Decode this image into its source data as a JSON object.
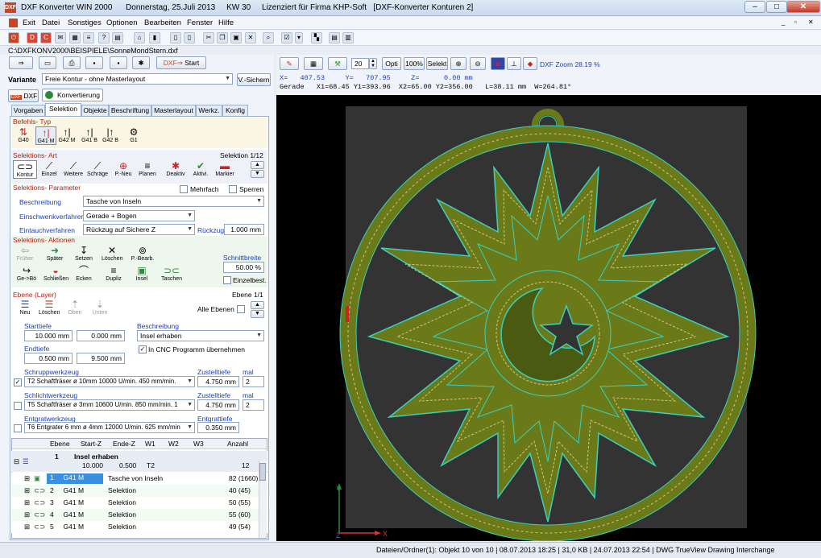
{
  "window": {
    "title": "DXF Konverter WIN 2000      Donnerstag, 25.Juli 2013     KW 30     Lizenziert für Firma KHP-Soft   [DXF-Konverter Konturen 2]",
    "app_icon": "DXF"
  },
  "menu": [
    "Exit",
    "Datei",
    "Sonstiges",
    "Optionen",
    "Bearbeiten",
    "Fenster",
    "Hilfe"
  ],
  "path": "C:\\DXFKONV2000\\BEISPIELE\\SonneMondStern.dxf",
  "start_label": "Start",
  "variante": {
    "label": "Variante",
    "value": "Freie Kontur - ohne Masterlayout",
    "save": "V.-Sichern"
  },
  "doc_tabs": [
    "DXF",
    "Konvertierung"
  ],
  "tabs": [
    "Vorgaben",
    "Selektion",
    "Objekte",
    "Beschriftung",
    "Masterlayout",
    "Werkz.",
    "Konfig"
  ],
  "befehl": {
    "title": "Befehls- Typ",
    "items": [
      "G40",
      "G41 M",
      "G42 M",
      "G41 B",
      "G42 B",
      "G1"
    ]
  },
  "selart": {
    "title": "Selektions- Art",
    "counter": "Selektion 1/12",
    "items": [
      "Kontur",
      "Einzel",
      "Weitere",
      "Schräge",
      "P.-Neu",
      "Planen",
      "Deaktiv",
      "Aktivi.",
      "Markier"
    ]
  },
  "param": {
    "title": "Selektions- Parameter",
    "mehrfach": "Mehrfach",
    "sperren": "Sperren",
    "beschreibung_label": "Beschreibung",
    "beschreibung": "Tasche von Inseln",
    "einschwenk_label": "Einschwenkverfahren",
    "einschwenk": "Gerade + Bogen",
    "eintauch_label": "Eintauchverfahren",
    "eintauch": "Rückzug auf Sichere Z",
    "rueckzug_label": "Rückzug",
    "rueckzug": "1.000 mm"
  },
  "aktionen": {
    "title": "Selektions- Aktionen",
    "row1": [
      "Früher",
      "Später",
      "Setzen",
      "Löschen",
      "P.-Bearb."
    ],
    "row2": [
      "Ge->Bö",
      "Schließen",
      "Ecken",
      "Dupliz",
      "Insel",
      "Taschen"
    ],
    "schnitt_label": "Schnittbreite",
    "schnitt": "50.00 %",
    "einzel": "Einzelbest."
  },
  "ebene": {
    "title": "Ebene (Layer)",
    "counter": "Ebene 1/1",
    "buttons": [
      "Neu",
      "Löschen",
      "Oben",
      "Unten"
    ],
    "alle": "Alle Ebenen",
    "starttiefe_label": "Starttiefe",
    "st1": "10.000 mm",
    "st2": "0.000 mm",
    "endtiefe_label": "Endtiefe",
    "et1": "0.500 mm",
    "et2": "9.500 mm",
    "beschreibung_label": "Beschreibung",
    "beschreibung": "Insel erhaben",
    "cnc": "In CNC Programm übernehmen"
  },
  "werkzeug": {
    "schrupp_label": "Schruppwerkzeug",
    "schrupp": "T2  Schaftfräser  ø 10mm  10000 U/min.  450 mm/min.",
    "zust1_label": "Zustelltiefe",
    "zust1": "4.750 mm",
    "mal_label": "mal",
    "mal1": "2",
    "schlicht_label": "Schlichtwerkzeug",
    "schlicht": "T5  Schaftfräser  ø 3mm  10600 U/min.  850 mm/min.  1",
    "zust2": "4.750 mm",
    "mal2": "2",
    "entgrat_label": "Entgratwerkzeug",
    "entgrat": "T6  Entgrater 6 mm  ø 4mm  12000 U/min.  625 mm/min",
    "entgrat_tiefe_label": "Entgrattiefe",
    "entgrat_tiefe": "0.350 mm"
  },
  "table": {
    "headers": [
      "Ebene",
      "Start-Z",
      "Ende-Z",
      "W1",
      "W2",
      "W3",
      "Anzahl"
    ],
    "group": {
      "num": "1",
      "name": "Insel erhaben",
      "sz": "10.000",
      "ez": "0.500",
      "tool": "T2",
      "count": "12"
    },
    "rows": [
      {
        "n": "1",
        "cmd": "G41 M",
        "desc": "Tasche von Inseln",
        "cnt": "82 (1660)"
      },
      {
        "n": "2",
        "cmd": "G41 M",
        "desc": "Selektion",
        "cnt": "40 (45)"
      },
      {
        "n": "3",
        "cmd": "G41 M",
        "desc": "Selektion",
        "cnt": "50 (55)"
      },
      {
        "n": "4",
        "cmd": "G41 M",
        "desc": "Selektion",
        "cnt": "55 (60)"
      },
      {
        "n": "5",
        "cmd": "G41 M",
        "desc": "Selektion",
        "cnt": "49 (54)"
      }
    ]
  },
  "viewer": {
    "zoom_value": "20",
    "opti": "Opti",
    "zoom100": "100%",
    "selekt": "Selekt",
    "zoom_label": "DXF Zoom 28.19 %",
    "coords": "X=   407.53     Y=   707.95     Z=      0.00 mm",
    "info": "Gerade   X1=68.45 Y1=393.96  X2=65.00 Y2=356.00   L=38.11 mm  W=264.81°",
    "axis_x": "X",
    "axis_y": "Y",
    "axis_z": "Z"
  },
  "status": "Dateien/Ordner(1): Objekt 10 von 10  |  08.07.2013 18:25  |  31,0 KB  |  24.07.2013 22:54  |  DWG TrueView Drawing Interchange",
  "colors": {
    "accent": "#1a3fae",
    "section": "#b02010",
    "olive": "#6b7a18",
    "contour": "#3ad0c0"
  }
}
